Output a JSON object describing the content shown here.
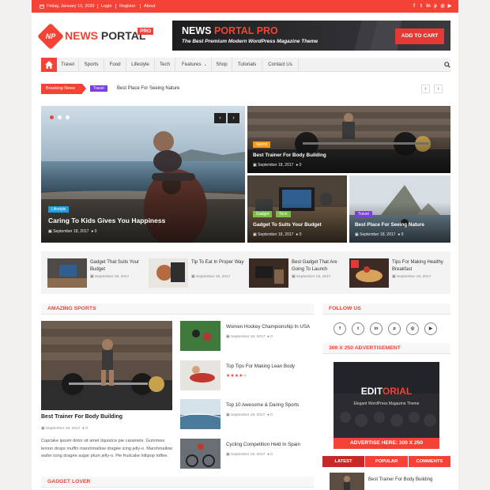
{
  "topbar": {
    "date": "Friday, January 10, 2020",
    "login": "Login",
    "register": "Register",
    "about": "About",
    "social_icons": [
      "facebook-icon",
      "twitter-icon",
      "linkedin-icon",
      "pinterest-icon",
      "instagram-icon",
      "youtube-icon"
    ]
  },
  "logo": {
    "badge": "NP",
    "word1": "NEWS",
    "word2": "PORTAL",
    "pro": "PRO"
  },
  "header_ad": {
    "title_part1": "NEWS",
    "title_part2": "PORTAL PRO",
    "subtitle": "The Best Premium Modern WordPress Magazine Theme",
    "button": "ADD TO CART"
  },
  "nav": {
    "items": [
      "Travel",
      "Sports",
      "Food",
      "Lifestyle",
      "Tech",
      "Features",
      "Shop",
      "Tutorials",
      "Contact Us"
    ]
  },
  "ticker": {
    "label": "Breaking News",
    "tag": "Travel",
    "text": "Best Place For Seeing Nature"
  },
  "featured": {
    "main": {
      "category": "Lifestyle",
      "title": "Caring To Kids Gives You Happiness",
      "date": "September 18, 2017",
      "comments": "0"
    },
    "top_right": {
      "category": "Sports",
      "title": "Best Trainer For Body Building",
      "date": "September 18, 2017",
      "comments": "0"
    },
    "bottom_left": {
      "categories": [
        "Gadget",
        "Tech"
      ],
      "title": "Gadget To Suits Your Budget",
      "date": "September 18, 2017",
      "comments": "0"
    },
    "bottom_right": {
      "category": "Travel",
      "title": "Best Place For Seeing Nature",
      "date": "September 18, 2017",
      "comments": "0"
    }
  },
  "small_posts": [
    {
      "title": "Gadget That Suits Your Budget",
      "date": "September 18, 2017"
    },
    {
      "title": "Tip To Eat In Proper Way",
      "date": "September 18, 2017"
    },
    {
      "title": "Best Gadget That Are Going To Launch",
      "date": "September 18, 2017"
    },
    {
      "title": "Tips For Making Healthy Breakfast",
      "date": "September 18, 2017"
    }
  ],
  "amazing_sports": {
    "heading": "AMAZING SPORTS",
    "main": {
      "title": "Best Trainer For Body Building",
      "date": "September 18, 2017",
      "comments": "0",
      "excerpt": "Cupcake ipsum dolor sit amet liquorice pie caramels. Gummies lemon drops muffin marshmallow dragée icing jelly-o. Marshmallow wafer icing dragée sugar plum jelly-o. Pie fruitcake lollipop toffee."
    },
    "list": [
      {
        "title": "Women Hockey Championship In USA",
        "date": "September 18, 2017",
        "comments": "0"
      },
      {
        "title": "Top Tips For Making Lean Body",
        "date": "September 18, 2017",
        "comments": "0",
        "rating": 4
      },
      {
        "title": "Top 10 Awesome & Daring Sports",
        "date": "September 18, 2017",
        "comments": "0"
      },
      {
        "title": "Cycling Competition Held In Spain",
        "date": "September 18, 2017",
        "comments": "0"
      }
    ]
  },
  "gadget_lover": {
    "heading": "GADGET LOVER"
  },
  "sidebar": {
    "follow_heading": "FOLLOW US",
    "social": [
      "facebook-icon",
      "twitter-icon",
      "linkedin-icon",
      "pinterest-icon",
      "instagram-icon",
      "youtube-icon"
    ],
    "ad_heading": "300 X 250 ADVERTISEMENT",
    "ad": {
      "title_part1": "EDIT",
      "title_part2": "ORIAL",
      "subtitle": "Elegant WordPress Magazine Theme",
      "cta": "ADVERTISE HERE: 300 X 250"
    },
    "tabs": [
      "LATEST",
      "POPULAR",
      "COMMENTS"
    ],
    "latest_item": {
      "title": "Best Trainer For Body Building"
    }
  },
  "colors": {
    "accent": "#f44336",
    "purple": "#7b3fe0",
    "lime": "#7bc043"
  }
}
